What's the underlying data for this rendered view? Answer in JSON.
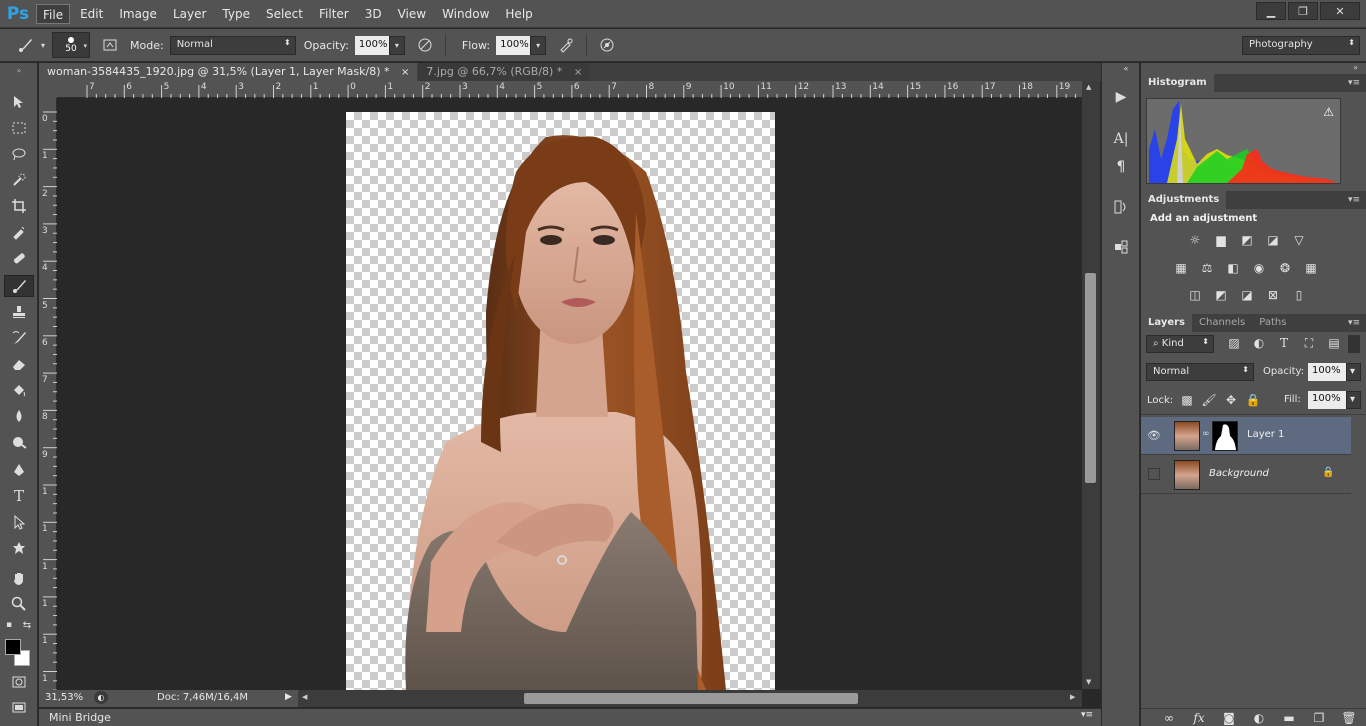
{
  "app": {
    "logo": "Ps",
    "menu": [
      "File",
      "Edit",
      "Image",
      "Layer",
      "Type",
      "Select",
      "Filter",
      "3D",
      "View",
      "Window",
      "Help"
    ],
    "window_controls": {
      "minimize": "▁",
      "restore": "❐",
      "close": "✕"
    }
  },
  "options": {
    "brush_size": "50",
    "mode_label": "Mode:",
    "mode_value": "Normal",
    "opacity_label": "Opacity:",
    "opacity_value": "100%",
    "flow_label": "Flow:",
    "flow_value": "100%",
    "workspace": "Photography"
  },
  "tabs": [
    {
      "title": "woman-3584435_1920.jpg @ 31,5% (Layer 1, Layer Mask/8) *",
      "close": "×"
    },
    {
      "title": "7.jpg @ 66,7% (RGB/8) *",
      "close": "×"
    }
  ],
  "rulers": {
    "top": [
      "7",
      "6",
      "5",
      "4",
      "3",
      "2",
      "1",
      "0",
      "1",
      "2",
      "3",
      "4",
      "5",
      "6",
      "7",
      "8",
      "9",
      "10",
      "11",
      "12",
      "13",
      "14",
      "15",
      "16",
      "17",
      "18",
      "19"
    ],
    "left": [
      "0",
      "1",
      "2",
      "3",
      "4",
      "5",
      "6",
      "7",
      "8",
      "9",
      "1",
      "1",
      "1",
      "1",
      "1",
      "1",
      "1"
    ]
  },
  "status": {
    "zoom": "31,53%",
    "doc": "Doc: 7,46M/16,4M"
  },
  "minibridge": "Mini Bridge",
  "panels": {
    "histogram_tab": "Histogram",
    "adjustments_tab": "Adjustments",
    "add_adjustment": "Add an adjustment",
    "layers_tabs": [
      "Layers",
      "Channels",
      "Paths"
    ],
    "kind_label": "Kind",
    "blend_mode": "Normal",
    "opacity_label": "Opacity:",
    "opacity_value": "100%",
    "lock_label": "Lock:",
    "fill_label": "Fill:",
    "fill_value": "100%",
    "layers": [
      {
        "name": "Layer 1",
        "visible": true,
        "selected": true
      },
      {
        "name": "Background",
        "visible": false,
        "selected": false
      }
    ]
  },
  "colors": {
    "accent_blue": "#2fa3e6",
    "panel_bg": "#535353",
    "canvas_bg": "#282828",
    "selected_layer": "#5d6a7f"
  }
}
